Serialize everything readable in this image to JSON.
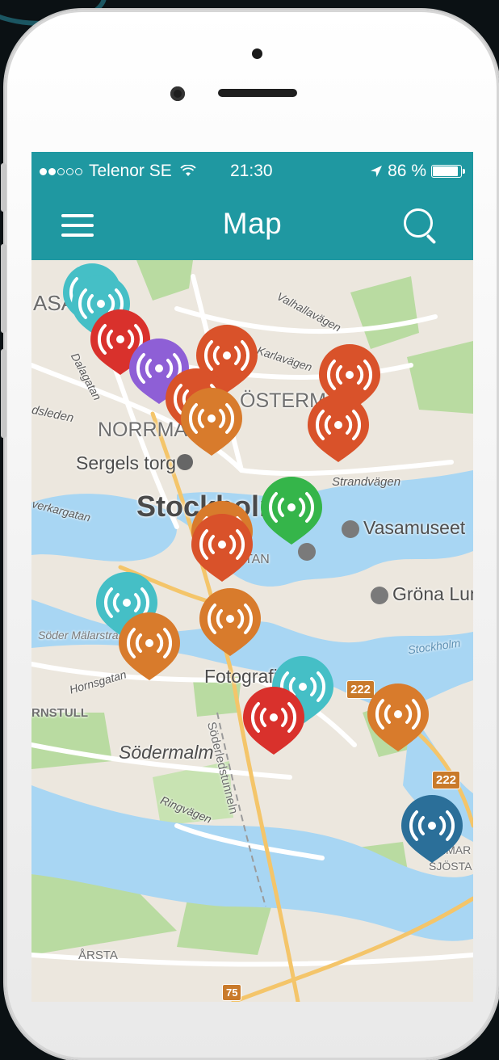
{
  "status_bar": {
    "signal_filled": 2,
    "signal_total": 5,
    "carrier": "Telenor SE",
    "wifi_icon": "wifi-icon",
    "time": "21:30",
    "location_icon": "location-arrow-icon",
    "battery_percent_text": "86 %",
    "battery_level": 0.86
  },
  "nav": {
    "title": "Map",
    "menu_icon": "hamburger-menu-icon",
    "search_icon": "search-icon"
  },
  "map": {
    "labels": {
      "vasa_partial": "ASA",
      "valhallavagen": "Valhallavägen",
      "karlavagen": "Karlavägen",
      "dalagatan": "Dalagatan",
      "vasavagen_partial": "dsleden",
      "norrmalm_partial": "NORRMA",
      "ostermalm_partial": "ÖSTERM",
      "sergels_torg": "Sergels torg",
      "strandvagen": "Strandvägen",
      "kungsgatan_partial": "verkargatan",
      "stockholm": "Stockholm",
      "vasamuseet": "Vasamuseet",
      "gamla_stan_partial": "TAN",
      "grona_lund": "Gröna Lund",
      "soder_malarstrand": "Söder Mälarstrand",
      "stockholm_water": "Stockholm",
      "hornsgatan": "Hornsgatan",
      "fotografiska": "Fotografiska",
      "hornstull_partial": "RNSTULL",
      "sodermalm": "Södermalm",
      "soderledstunneln": "Söderledstunneln",
      "ringvagen": "Ringvägen",
      "hammarby_1": "HAMMAR",
      "hammarby_2": "SJÖSTA",
      "arsta": "ÅRSTA"
    },
    "road_shields": [
      "222",
      "222",
      "75"
    ],
    "marker_icon": "broadcast-signal-icon",
    "marker_colors": {
      "teal": "#45bfc6",
      "red": "#d9312c",
      "purple": "#8e5fd6",
      "orange_red": "#d9522a",
      "orange": "#d87b2c",
      "green": "#35b54a",
      "navy": "#2b6f99"
    }
  },
  "theme": {
    "accent": "#1f98a1",
    "water": "#a8d6f3",
    "park": "#b9dba1",
    "land": "#ece7de"
  }
}
